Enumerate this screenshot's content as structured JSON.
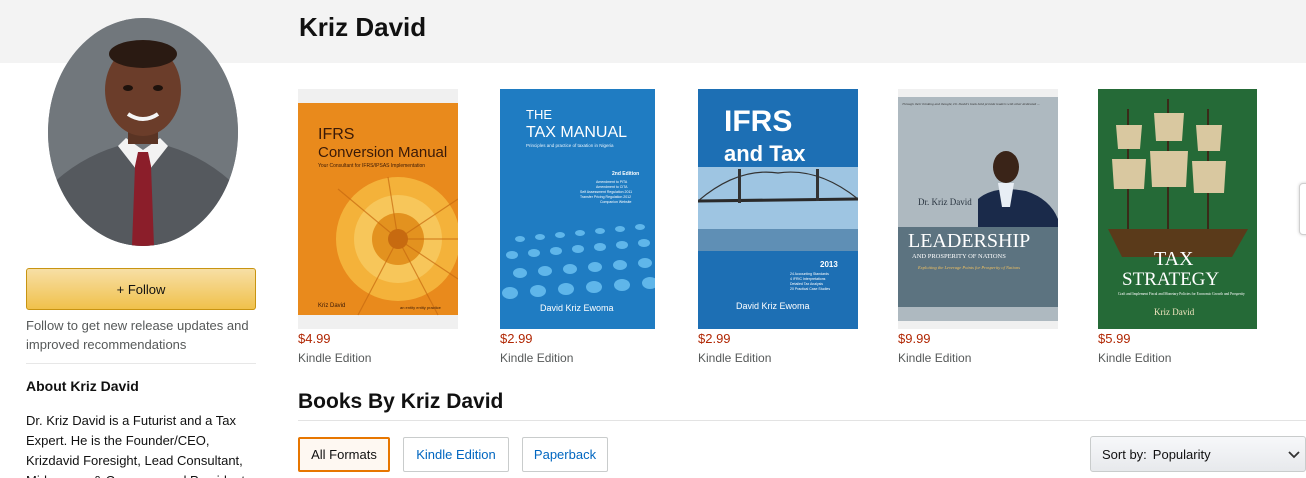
{
  "author": {
    "name": "Kriz David"
  },
  "sidebar": {
    "follow_label": "+ Follow",
    "follow_note": "Follow to get new release updates and improved recommendations",
    "about_title": "About Kriz David",
    "about_text": "Dr. Kriz David is a Futurist and a Tax Expert. He is the Founder/CEO, Krizdavid Foresight, Lead Consultant, Midasgage & Company and President"
  },
  "books": [
    {
      "price": "$4.99",
      "format": "Kindle Edition",
      "cover": {
        "title_line1": "IFRS",
        "title_line2": "Conversion Manual",
        "subtitle": "Your Consultant for IFRS/IPSAS Implementation",
        "author": "Kriz David",
        "tagline": "an entity entity practice"
      }
    },
    {
      "price": "$2.99",
      "format": "Kindle Edition",
      "cover": {
        "title_line1": "THE",
        "title_line2": "TAX MANUAL",
        "subtitle": "Principles and practice of taxation in Nigeria",
        "edition": "2nd Edition",
        "notes": [
          "Amendment to PITA",
          "Amendment to CITA",
          "Self Assessment Regulation 2011",
          "Transfer Pricing Regulation 2012",
          "Companion Website"
        ],
        "author": "David Kriz Ewoma"
      }
    },
    {
      "price": "$2.99",
      "format": "Kindle Edition",
      "cover": {
        "title_line1": "IFRS",
        "title_line2": "and Tax",
        "year": "2013",
        "notes": [
          "24 Accounting Standards",
          "4 IFRIC Interpretations",
          "Detailed Tax Analysis",
          "20 Practical Case Studies"
        ],
        "author": "David Kriz Ewoma"
      }
    },
    {
      "price": "$9.99",
      "format": "Kindle Edition",
      "cover": {
        "quote": "Through their thinking and thought, Dr. David's book hold provide leaders with other dedicated ...",
        "author": "Dr. Kriz David",
        "title_line1": "LEADERSHIP",
        "title_line2": "AND PROSPERITY OF NATIONS",
        "subtitle": "Exploiting the Leverage Points for Prosperity of Nations"
      }
    },
    {
      "price": "$5.99",
      "format": "Kindle Edition",
      "cover": {
        "title_line1": "TAX",
        "title_line2": "STRATEGY",
        "subtitle": "Craft and Implement Fiscal and Monetary Policies for Economic Growth and Prosperity",
        "author": "Kriz David"
      }
    }
  ],
  "books_section": {
    "title": "Books By Kriz David",
    "filters": [
      "All Formats",
      "Kindle Edition",
      "Paperback"
    ],
    "sort_label": "Sort by:",
    "sort_value": "Popularity"
  },
  "colors": {
    "price": "#b12704",
    "follow_button": "#f0c14b",
    "active_filter_border": "#e77600",
    "link": "#0066c0"
  }
}
